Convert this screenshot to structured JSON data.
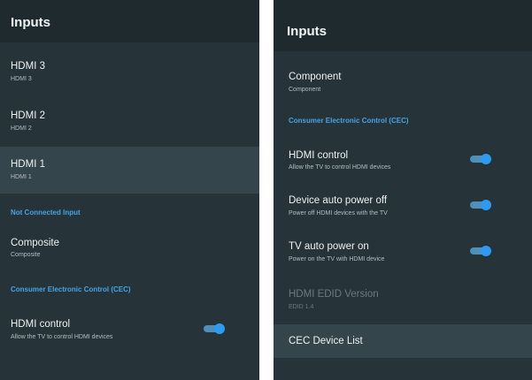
{
  "left_panel": {
    "title": "Inputs",
    "items": [
      {
        "title": "HDMI 3",
        "subtitle": "HDMI 3"
      },
      {
        "title": "HDMI 2",
        "subtitle": "HDMI 2"
      },
      {
        "title": "HDMI 1",
        "subtitle": "HDMI 1"
      }
    ],
    "section_not_connected": "Not Connected Input",
    "composite": {
      "title": "Composite",
      "subtitle": "Composite"
    },
    "section_cec": "Consumer Electronic Control (CEC)",
    "hdmi_control": {
      "title": "HDMI control",
      "subtitle": "Allow the TV to control HDMI devices",
      "enabled": true
    }
  },
  "right_panel": {
    "title": "Inputs",
    "component": {
      "title": "Component",
      "subtitle": "Component"
    },
    "section_cec": "Consumer Electronic Control (CEC)",
    "hdmi_control": {
      "title": "HDMI control",
      "subtitle": "Allow the TV to control HDMI devices",
      "enabled": true
    },
    "device_auto_power_off": {
      "title": "Device auto power off",
      "subtitle": "Power off HDMI devices with the TV",
      "enabled": true
    },
    "tv_auto_power_on": {
      "title": "TV auto power on",
      "subtitle": "Power on the TV with HDMI device",
      "enabled": true
    },
    "hdmi_edid": {
      "title": "HDMI EDID Version",
      "subtitle": "EDID 1.4"
    },
    "cec_device_list": {
      "title": "CEC Device List"
    }
  },
  "colors": {
    "panel_bg": "#263338",
    "header_bg": "#1f2a2f",
    "focus_bg": "#34454b",
    "accent": "#45a4e6",
    "toggle_on": "#2f9bf0"
  }
}
